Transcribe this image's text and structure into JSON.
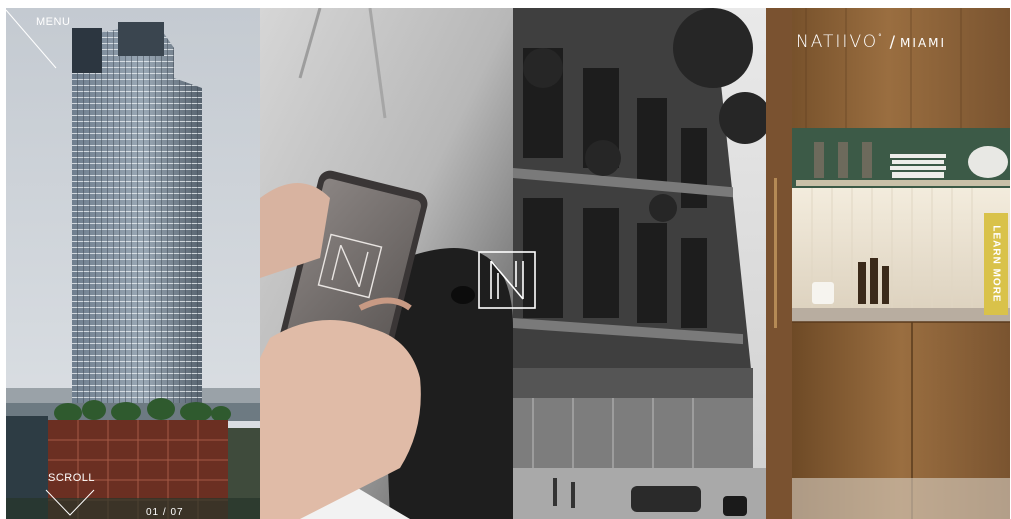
{
  "nav": {
    "menu_label": "MENU"
  },
  "brand": {
    "name": "NATIIVO",
    "tm": "°",
    "separator": "/",
    "city": "MIAMI"
  },
  "cta": {
    "learn_more": "LEARN MORE"
  },
  "scroll": {
    "label": "SCROLL"
  },
  "slider": {
    "counter": "01 / 07"
  },
  "colors": {
    "accent": "#d9c24a",
    "cabinet_green": "#3c5a47",
    "wood": "#8a6237"
  },
  "icons": {
    "menu": "diagonal-line-icon",
    "scroll": "chevron-down-icon",
    "logo": "n-monogram-icon"
  }
}
